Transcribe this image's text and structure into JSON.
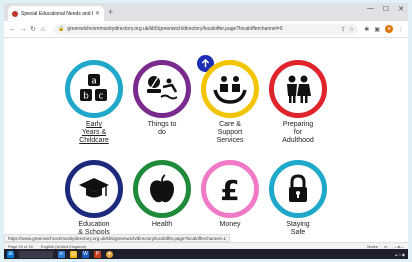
{
  "browser": {
    "tab_title": "Special Educational Needs and Dis…",
    "new_tab": "+",
    "url": "greenwichcommunitydirectory.org.uk/kb5/greenwich/directory/localoffer.page?localofferchannel=0",
    "status_url": "https://www.greenwichcommunitydirectory.org.uk/kb5/greenwich/directory/localoffer.page?localofferchannel=1"
  },
  "colors": {
    "early_years": "#1fa8c9",
    "things_to_do": "#7a2a8c",
    "care_support": "#f2c500",
    "adulthood": "#e0242b",
    "education": "#1b2a7a",
    "health": "#1e8a3a",
    "money": "#f07ac6",
    "staying_safe": "#1fa8c9",
    "back_to_top": "#1d2fb5"
  },
  "categories": [
    {
      "label": "Early Years & Childcare",
      "lines": [
        "Early",
        "Years &",
        "Childcare"
      ],
      "icon": "abc-blocks-icon",
      "link": true
    },
    {
      "label": "Things to do",
      "lines": [
        "Things to",
        "do"
      ],
      "icon": "activities-icon",
      "link": false
    },
    {
      "label": "Care & Support Services",
      "lines": [
        "Care &",
        "Support",
        "Services"
      ],
      "icon": "care-hands-icon",
      "link": false
    },
    {
      "label": "Preparing for Adulthood",
      "lines": [
        "Preparing",
        "for",
        "Adulthood"
      ],
      "icon": "people-icon",
      "link": false
    },
    {
      "label": "Education & Schools",
      "lines": [
        "Education",
        "& Schools"
      ],
      "icon": "graduation-cap-icon",
      "link": false
    },
    {
      "label": "Health",
      "lines": [
        "Health"
      ],
      "icon": "apple-icon",
      "link": false
    },
    {
      "label": "Money",
      "lines": [
        "Money"
      ],
      "icon": "pound-icon",
      "link": false
    },
    {
      "label": "Staying Safe",
      "lines": [
        "Staying",
        "Safe"
      ],
      "icon": "padlock-icon",
      "link": false
    }
  ],
  "docbar": {
    "page": "Page 15 of 16",
    "language": "English (United Kingdom)",
    "notes": "Notes"
  }
}
